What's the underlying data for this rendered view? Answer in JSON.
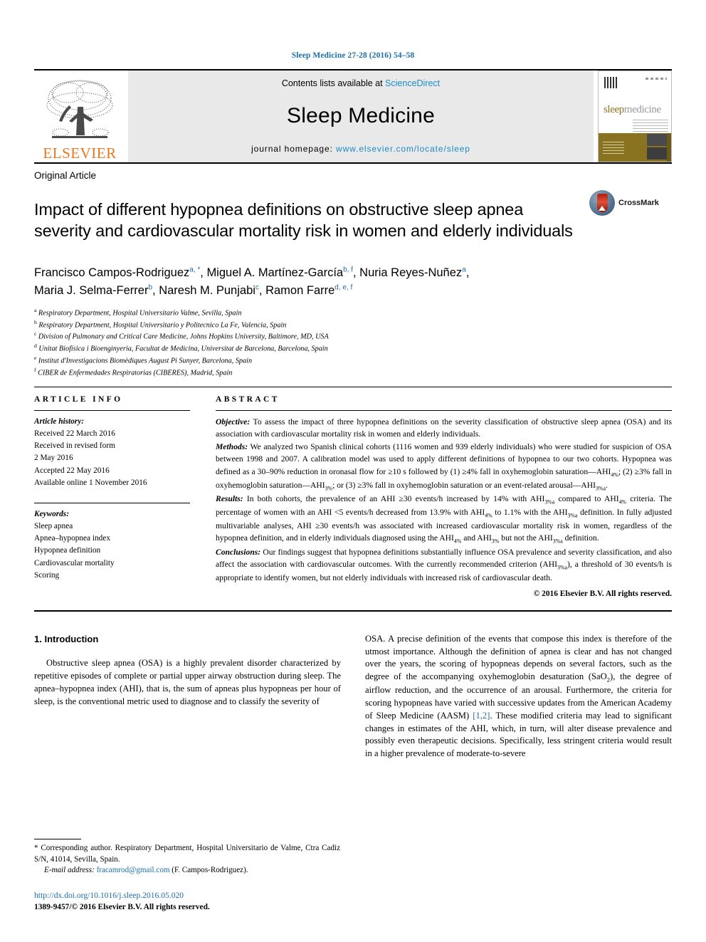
{
  "running_head": "Sleep Medicine 27-28 (2016) 54–58",
  "masthead": {
    "publisher_name": "ELSEVIER",
    "contents_prefix": "Contents lists available at ",
    "contents_link": "ScienceDirect",
    "journal_title": "Sleep Medicine",
    "homepage_prefix": "journal homepage: ",
    "homepage_url": "www.elsevier.com/locate/sleep",
    "cover_title_a": "sleep",
    "cover_title_b": "medicine"
  },
  "article": {
    "type": "Original Article",
    "title": "Impact of different hypopnea definitions on obstructive sleep apnea severity and cardiovascular mortality risk in women and elderly individuals",
    "crossmark_label": "CrossMark",
    "authors_line_1_parts": [
      {
        "name": "Francisco Campos-Rodriguez",
        "sup": "a, *"
      },
      {
        "name": "Miguel A. Martínez-García",
        "sup": "b, f"
      },
      {
        "name": "Nuria Reyes-Nuñez",
        "sup": "a"
      }
    ],
    "authors_line_2_parts": [
      {
        "name": "Maria J. Selma-Ferrer",
        "sup": "b"
      },
      {
        "name": "Naresh M. Punjabi",
        "sup": "c"
      },
      {
        "name": "Ramon Farre",
        "sup": "d, e, f"
      }
    ],
    "affiliations": [
      {
        "mark": "a",
        "text": "Respiratory Department, Hospital Universitario Valme, Sevilla, Spain"
      },
      {
        "mark": "b",
        "text": "Respiratory Department, Hospital Universitario y Politecnico La Fe, Valencia, Spain"
      },
      {
        "mark": "c",
        "text": "Division of Pulmonary and Critical Care Medicine, Johns Hopkins University, Baltimore, MD, USA"
      },
      {
        "mark": "d",
        "text": "Unitat Biofísica i Bioenginyeria, Facultat de Medicina, Universitat de Barcelona, Barcelona, Spain"
      },
      {
        "mark": "e",
        "text": "Institut d'Investigacions Biomèdiques August Pi Sunyer, Barcelona, Spain"
      },
      {
        "mark": "f",
        "text": "CIBER de Enfermedades Respiratorias (CIBERES), Madrid, Spain"
      }
    ]
  },
  "article_info": {
    "heading": "ARTICLE INFO",
    "history_label": "Article history:",
    "history": [
      "Received 22 March 2016",
      "Received in revised form",
      "2 May 2016",
      "Accepted 22 May 2016",
      "Available online 1 November 2016"
    ],
    "keywords_label": "Keywords:",
    "keywords": [
      "Sleep apnea",
      "Apnea–hypopnea index",
      "Hypopnea definition",
      "Cardiovascular mortality",
      "Scoring"
    ]
  },
  "abstract": {
    "heading": "ABSTRACT",
    "objective_label": "Objective:",
    "objective_text": " To assess the impact of three hypopnea definitions on the severity classification of obstructive sleep apnea (OSA) and its association with cardiovascular mortality risk in women and elderly individuals.",
    "methods_label": "Methods:",
    "methods_text_1": " We analyzed two Spanish clinical cohorts (1116 women and 939 elderly individuals) who were studied for suspicion of OSA between 1998 and 2007. A calibration model was used to apply different definitions of hypopnea to our two cohorts. Hypopnea was defined as a 30–90% reduction in oronasal flow for ≥10 s followed by (1) ≥4% fall in oxyhemoglobin saturation—AHI",
    "methods_sub_1": "4%",
    "methods_text_2": "; (2) ≥3% fall in oxyhemoglobin saturation—AHI",
    "methods_sub_2": "3%",
    "methods_text_3": "; or (3) ≥3% fall in oxyhemoglobin saturation or an event-related arousal—AHI",
    "methods_sub_3": "3%a",
    "methods_text_4": ".",
    "results_label": "Results:",
    "results_text_1": " In both cohorts, the prevalence of an AHI ≥30 events/h increased by 14% with AHI",
    "results_sub_1": "3%a",
    "results_text_2": " compared to AHI",
    "results_sub_2": "4%",
    "results_text_3": " criteria. The percentage of women with an AHI <5 events/h decreased from 13.9% with AHI",
    "results_sub_3": "4%",
    "results_text_4": " to 1.1% with the AHI",
    "results_sub_4": "3%a",
    "results_text_5": " definition. In fully adjusted multivariable analyses, AHI ≥30 events/h was associated with increased cardiovascular mortality risk in women, regardless of the hypopnea definition, and in elderly individuals diagnosed using the AHI",
    "results_sub_5": "4%",
    "results_text_6": " and AHI",
    "results_sub_6": "3%",
    "results_text_7": " but not the AHI",
    "results_sub_7": "3%a",
    "results_text_8": " definition.",
    "conclusions_label": "Conclusions:",
    "conclusions_text_1": " Our findings suggest that hypopnea definitions substantially influence OSA prevalence and severity classification, and also affect the association with cardiovascular outcomes. With the currently recommended criterion (AHI",
    "conclusions_sub_1": "3%a",
    "conclusions_text_2": "), a threshold of 30 events/h is appropriate to identify women, but not elderly individuals with increased risk of cardiovascular death.",
    "copyright": "© 2016 Elsevier B.V. All rights reserved."
  },
  "introduction": {
    "section_number_title": "1. Introduction",
    "left_paragraph": "Obstructive sleep apnea (OSA) is a highly prevalent disorder characterized by repetitive episodes of complete or partial upper airway obstruction during sleep. The apnea–hypopnea index (AHI), that is, the sum of apneas plus hypopneas per hour of sleep, is the conventional metric used to diagnose and to classify the severity of",
    "right_text_1": "OSA. A precise definition of the events that compose this index is therefore of the utmost importance. Although the definition of apnea is clear and has not changed over the years, the scoring of hypopneas depends on several factors, such as the degree of the accompanying oxyhemoglobin desaturation (SaO",
    "right_sub_1": "2",
    "right_text_2": "), the degree of airflow reduction, and the occurrence of an arousal. Furthermore, the criteria for scoring hypopneas have varied with successive updates from the American Academy of Sleep Medicine (AASM) ",
    "right_citation": "[1,2]",
    "right_text_3": ". These modified criteria may lead to significant changes in estimates of the AHI, which, in turn, will alter disease prevalence and possibly even therapeutic decisions. Specifically, less stringent criteria would result in a higher prevalence of moderate-to-severe"
  },
  "footnote": {
    "corresponding_marker": "*",
    "corresponding_text": " Corresponding author. Respiratory Department, Hospital Universitario de Valme, Ctra Cadiz S/N, 41014, Sevilla, Spain.",
    "email_label": "E-mail address:",
    "email": "fracamrod@gmail.com",
    "email_suffix": " (F. Campos-Rodriguez).",
    "doi_url": "http://dx.doi.org/10.1016/j.sleep.2016.05.020",
    "issn_line": "1389-9457/© 2016 Elsevier B.V. All rights reserved."
  },
  "colors": {
    "link": "#1a6fa8",
    "sciencedirect": "#1a8cc8",
    "elsevier_orange": "#e87722",
    "cover_olive": "#8a7320"
  }
}
